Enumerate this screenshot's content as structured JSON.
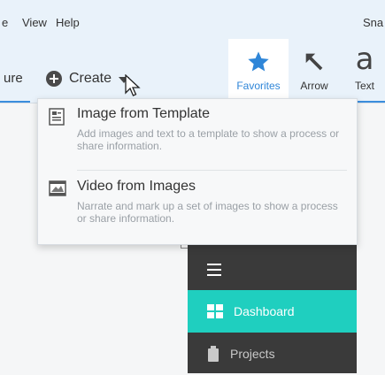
{
  "menubar": {
    "items": [
      "e",
      "View",
      "Help"
    ],
    "right": "Sna"
  },
  "toolbar": {
    "tab_partial": "ure",
    "create_label": "Create",
    "tools": [
      {
        "label": "Favorites",
        "icon": "star-icon"
      },
      {
        "label": "Arrow",
        "icon": "arrow-icon"
      },
      {
        "label": "Text",
        "icon": "text-icon",
        "glyph": "a"
      }
    ]
  },
  "dropdown": {
    "items": [
      {
        "title": "Image from Template",
        "desc": "Add images and text to a template to show a process or share information.",
        "icon": "template-icon"
      },
      {
        "title": "Video from Images",
        "desc": "Narrate and mark up a set of images to show a process or share information.",
        "icon": "video-images-icon"
      }
    ]
  },
  "dashboard": {
    "items": [
      {
        "label": "Dashboard",
        "icon": "dashboard-icon"
      },
      {
        "label": "Projects",
        "icon": "projects-icon"
      }
    ]
  },
  "colors": {
    "accent": "#2f86d8",
    "teal": "#1fcfbf",
    "dark": "#3a3a3a"
  }
}
